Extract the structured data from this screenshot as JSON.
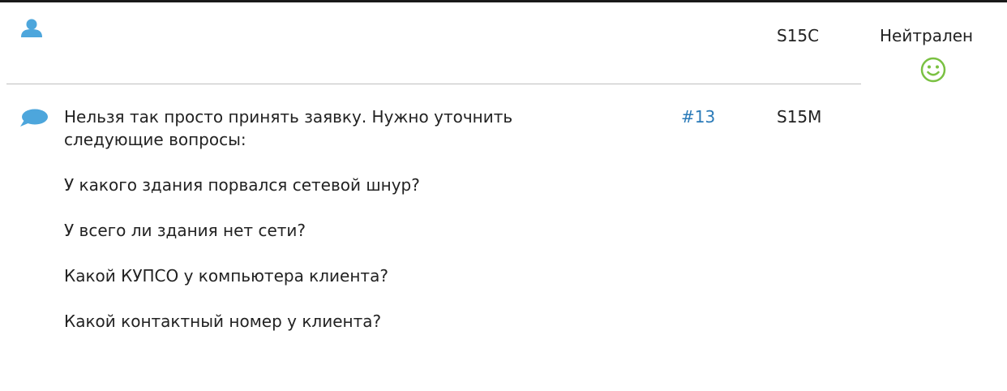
{
  "colors": {
    "icon_blue": "#4da6dc",
    "link_blue": "#2a7ab8",
    "smiley_green": "#7ac142",
    "divider": "#bfbfbf",
    "text": "#222222"
  },
  "header_row": {
    "user_icon": "user-icon",
    "user_code": "S15C",
    "mood": {
      "label": "Нейтрален",
      "icon": "smiley-icon"
    }
  },
  "comment_row": {
    "icon": "comment-icon",
    "intro": "Нельзя так просто принять заявку. Нужно уточнить следующие вопросы:",
    "questions": [
      "У какого здания порвался сетевой шнур?",
      "У всего ли здания нет сети?",
      "Какой КУПСО у компьютера клиента?",
      "Какой контактный номер у клиента?"
    ],
    "ticket_link": "#13",
    "user_code": "S15M"
  }
}
